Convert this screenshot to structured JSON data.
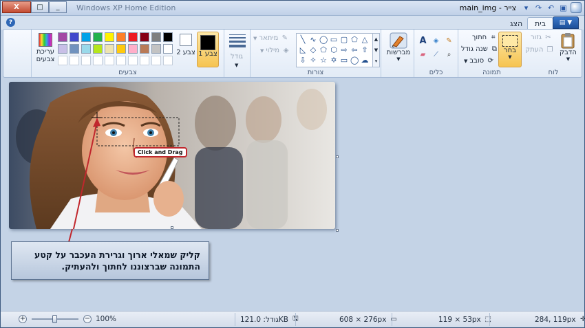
{
  "window": {
    "title": "main_img - צייר",
    "background_title": "Windows XP Home Edition",
    "controls": {
      "minimize": "_",
      "maximize": "□",
      "close": "X"
    },
    "quick_access": [
      "save-icon",
      "undo-icon",
      "redo-icon",
      "customize-icon"
    ]
  },
  "tabs": {
    "file_menu": "▼",
    "items": [
      {
        "label": "בית",
        "active": true
      },
      {
        "label": "הצג",
        "active": false
      }
    ]
  },
  "ribbon": {
    "clipboard": {
      "label": "לוח",
      "paste": "הדבק",
      "cut": "גזור",
      "copy": "העתק"
    },
    "image": {
      "label": "תמונה",
      "select": "בחר",
      "crop": "חתוך",
      "resize": "שנה גודל",
      "rotate": "סובב"
    },
    "tools": {
      "label": "כלים"
    },
    "brushes": {
      "label": "מברשות"
    },
    "shapes": {
      "label": "צורות",
      "outline": "מיתאר",
      "fill": "מילוי"
    },
    "size": {
      "label": "גודל"
    },
    "colors": {
      "label": "צבעים",
      "color1": "צבע 1",
      "color2": "צבע 2",
      "edit_colors": "עריכת צבעים",
      "palette": [
        "#000000",
        "#7f7f7f",
        "#880015",
        "#ed1c24",
        "#ff7f27",
        "#fff200",
        "#22b14c",
        "#00a2e8",
        "#3f48cc",
        "#a349a4",
        "#ffffff",
        "#c3c3c3",
        "#b97a57",
        "#ffaec9",
        "#ffc90e",
        "#efe4b0",
        "#b5e61d",
        "#99d9ea",
        "#7092be",
        "#c8bfe7"
      ]
    }
  },
  "canvas": {
    "tooltip": "Click and Drag"
  },
  "note": {
    "text": "קליק שמאלי ארוך וגרירת העכבר על קטע התמונה שברצוננו לחתוך ולהעתיק."
  },
  "statusbar": {
    "cursor_pos": "284, 119px",
    "selection_size": "119 × 53px",
    "image_size": "608 × 276px",
    "file_size": "גודל: 121.0KB",
    "zoom": "100%"
  }
}
